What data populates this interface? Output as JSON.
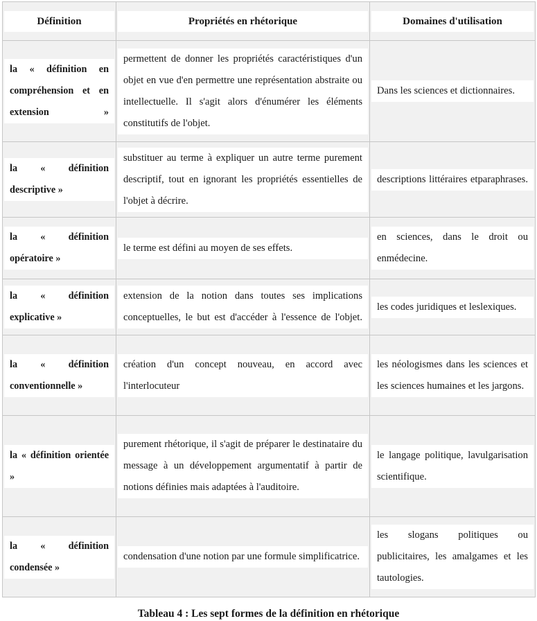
{
  "document": {
    "caption": "Tableau 4 : Les sept formes de la définition en rhétorique"
  },
  "table": {
    "columns": [
      {
        "id": "definition",
        "header": "Définition"
      },
      {
        "id": "proprietes",
        "header": "Propriétés en rhétorique"
      },
      {
        "id": "domaines",
        "header": "Domaines d'utilisation"
      }
    ],
    "rows": [
      {
        "definition": "la « définition en compréhension et en extension »",
        "proprietes": "permettent de donner les propriétés caractéristiques d'un objet en vue d'en permettre une représentation abstraite ou intellectuelle. Il s'agit alors d'énumérer les éléments constitutifs de l'objet.",
        "domaines": "Dans les sciences et dictionnaires."
      },
      {
        "definition": "la « définition descriptive »",
        "proprietes": "substituer au terme à expliquer un autre terme purement descriptif, tout en ignorant les propriétés essentielles de l'objet à décrire.",
        "domaines": "descriptions littéraires etparaphrases."
      },
      {
        "definition": "la « définition opératoire »",
        "proprietes": "le terme est défini au moyen de ses effets.",
        "domaines": "en sciences, dans le droit ou enmédecine."
      },
      {
        "definition": "la « définition explicative »",
        "proprietes": "extension de la notion dans toutes ses implications conceptuelles, le but est d'accéder à l'essence de l'objet.",
        "domaines": "les codes juridiques et leslexiques."
      },
      {
        "definition": "la « définition conventionnelle »",
        "proprietes": "création d'un concept nouveau, en accord avec l'interlocuteur",
        "domaines": "les néologismes dans les sciences et les sciences humaines et les jargons."
      },
      {
        "definition": "la « définition orientée »",
        "proprietes": "purement rhétorique, il s'agit de préparer le destinataire du message à un développement argumentatif à partir de notions définies mais adaptées à l'auditoire.",
        "domaines": "le langage politique, lavulgarisation scientifique."
      },
      {
        "definition": "la « définition condensée »",
        "proprietes": "condensation d'une notion par une formule simplificatrice.",
        "domaines": "les slogans politiques ou publicitaires, les amalgames et les tautologies."
      }
    ]
  },
  "theme": {
    "page_background": "#ffffff",
    "cell_background": "#f1f1f1",
    "text_background": "#ffffff",
    "border_color": "#c6c6c6",
    "text_color": "#1a1a1a"
  }
}
